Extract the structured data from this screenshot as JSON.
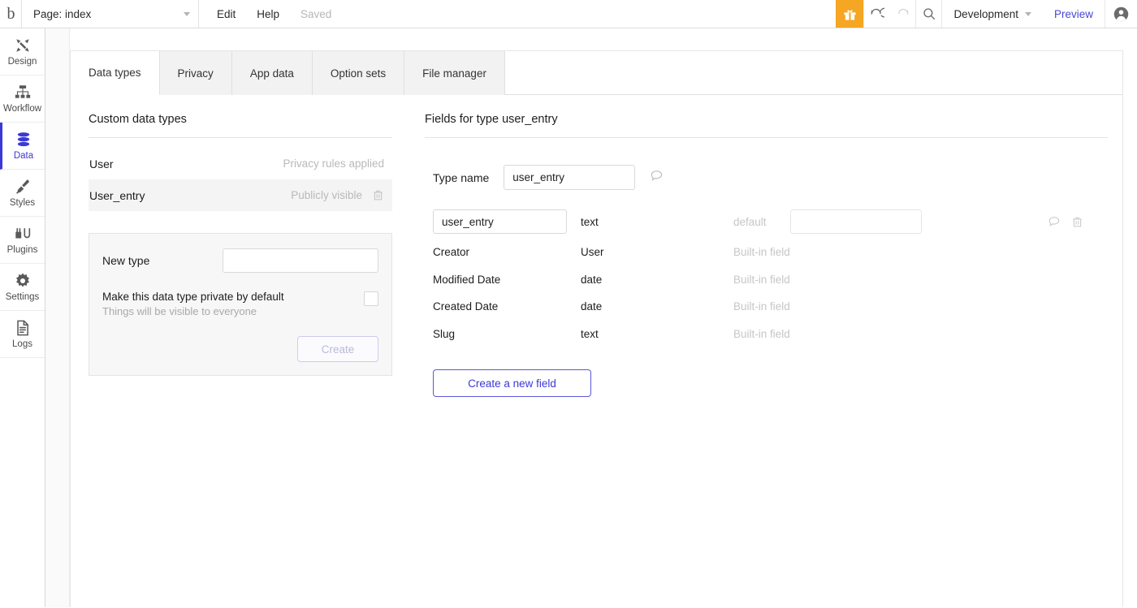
{
  "topbar": {
    "logo": "b",
    "page_label": "Page: index",
    "edit_label": "Edit",
    "help_label": "Help",
    "saved_label": "Saved",
    "gift_icon": "gift-icon",
    "undo_icon": "undo-icon",
    "redo_icon": "redo-icon",
    "search_icon": "search-icon",
    "env_label": "Development",
    "preview_label": "Preview",
    "account_icon": "account-icon",
    "accent_gift": "#f5a623",
    "accent_link": "#4a47d5"
  },
  "sidebar": {
    "active_color": "#3b38d8",
    "items": [
      {
        "label": "Design",
        "icon": "design-icon",
        "active": false
      },
      {
        "label": "Workflow",
        "icon": "workflow-icon",
        "active": false
      },
      {
        "label": "Data",
        "icon": "database-icon",
        "active": true
      },
      {
        "label": "Styles",
        "icon": "brush-icon",
        "active": false
      },
      {
        "label": "Plugins",
        "icon": "plugin-icon",
        "active": false
      },
      {
        "label": "Settings",
        "icon": "gear-icon",
        "active": false
      },
      {
        "label": "Logs",
        "icon": "document-icon",
        "active": false
      }
    ]
  },
  "tabs": [
    {
      "label": "Data types",
      "active": true
    },
    {
      "label": "Privacy",
      "active": false
    },
    {
      "label": "App data",
      "active": false
    },
    {
      "label": "Option sets",
      "active": false
    },
    {
      "label": "File manager",
      "active": false
    }
  ],
  "left_panel": {
    "title": "Custom data types",
    "types": [
      {
        "name": "User",
        "meta": "Privacy rules applied",
        "selected": false,
        "has_trash": false
      },
      {
        "name": "User_entry",
        "meta": "Publicly visible",
        "selected": true,
        "has_trash": true
      }
    ],
    "new_type": {
      "label": "New type",
      "input_value": "",
      "input_placeholder": "",
      "private_title": "Make this data type private by default",
      "private_sub": "Things will be visible to everyone",
      "checkbox_checked": false,
      "create_label": "Create"
    }
  },
  "right_panel": {
    "title": "Fields for type user_entry",
    "type_name_label": "Type name",
    "type_name_value": "user_entry",
    "comment_icon": "comment-icon",
    "default_label": "default",
    "default_value": "",
    "trash_icon": "trash-icon",
    "fields": [
      {
        "name": "user_entry",
        "type": "text",
        "note": "",
        "editable": true
      },
      {
        "name": "Creator",
        "type": "User",
        "note": "Built-in field",
        "editable": false
      },
      {
        "name": "Modified Date",
        "type": "date",
        "note": "Built-in field",
        "editable": false
      },
      {
        "name": "Created Date",
        "type": "date",
        "note": "Built-in field",
        "editable": false
      },
      {
        "name": "Slug",
        "type": "text",
        "note": "Built-in field",
        "editable": false
      }
    ],
    "new_field_label": "Create a new field"
  }
}
